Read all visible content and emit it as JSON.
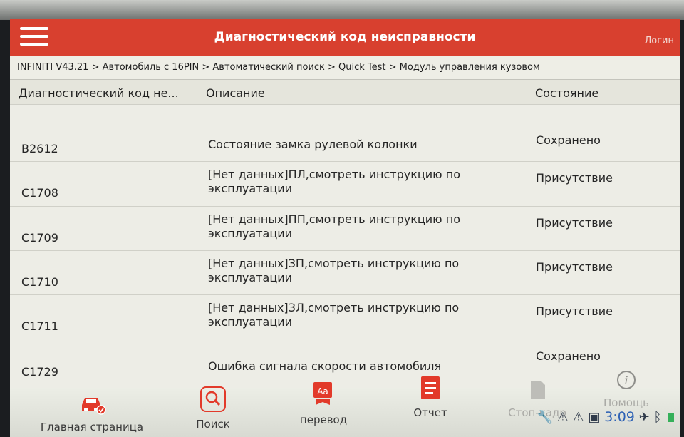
{
  "appbar": {
    "title": "Диагностический код неисправности",
    "login": "Логин"
  },
  "breadcrumb": "INFINITI V43.21 > Автомобиль с 16PIN > Автоматический поиск > Quick Test > Модуль управления кузовом",
  "table": {
    "headers": {
      "code": "Диагностический код не...",
      "description": "Описание",
      "state": "Состояние"
    },
    "rows": [
      {
        "code": "B2612",
        "description": "Состояние замка рулевой колонки",
        "state": "Сохранено"
      },
      {
        "code": "C1708",
        "description": "[Нет данных]ПЛ,смотреть инструкцию по эксплуатации",
        "state": "Присутствие"
      },
      {
        "code": "C1709",
        "description": "[Нет данных]ПП,смотреть инструкцию по эксплуатации",
        "state": "Присутствие"
      },
      {
        "code": "C1710",
        "description": "[Нет данных]ЗП,смотреть инструкцию по эксплуатации",
        "state": "Присутствие"
      },
      {
        "code": "C1711",
        "description": "[Нет данных]ЗЛ,смотреть инструкцию по эксплуатации",
        "state": "Присутствие"
      },
      {
        "code": "C1729",
        "description": "Ошибка сигнала скорости автомобиля",
        "state": "Сохранено"
      }
    ]
  },
  "bottom_nav": {
    "home": "Главная страница",
    "search": "Поиск",
    "translate": "перевод",
    "report": "Отчет",
    "freeze_frame": "Стоп-кадр",
    "help": "Помощь"
  },
  "status_bar": {
    "time": "3:09"
  },
  "colors": {
    "appbar": "#d8402f",
    "accent": "#e23a2a",
    "time": "#2e62b5"
  },
  "icons": [
    "menu-icon",
    "car-home-icon",
    "search-icon",
    "translate-icon",
    "report-icon",
    "freeze-frame-icon",
    "help-icon",
    "wrench-icon",
    "warning-icon",
    "bluetooth-icon",
    "battery-icon"
  ]
}
